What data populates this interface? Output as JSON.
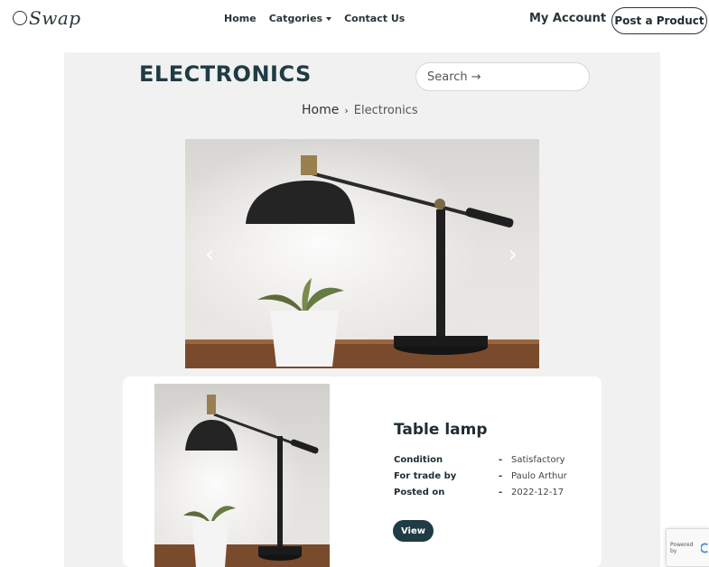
{
  "brand": {
    "name": "Swap"
  },
  "nav": {
    "home": "Home",
    "categories": "Catgories",
    "contact": "Contact Us",
    "account": "My Account",
    "post_product": "Post a Product"
  },
  "category": {
    "title": "ELECTRONICS",
    "search_placeholder": "Search →"
  },
  "breadcrumb": {
    "home": "Home",
    "separator": "›",
    "current": "Electronics"
  },
  "carousel": {
    "prev_icon": "‹",
    "next_icon": "›"
  },
  "product": {
    "title": "Table lamp",
    "details": [
      {
        "label": "Condition",
        "value": "Satisfactory"
      },
      {
        "label": "For trade by",
        "value": "Paulo Arthur"
      },
      {
        "label": "Posted on",
        "value": "2022-12-17"
      }
    ],
    "dash": "-",
    "view_label": "View"
  },
  "recaptcha": {
    "text": "Powered by"
  },
  "colors": {
    "primary": "#1f3b44",
    "panel": "#f1f1f1",
    "text": "#1f2d33"
  }
}
